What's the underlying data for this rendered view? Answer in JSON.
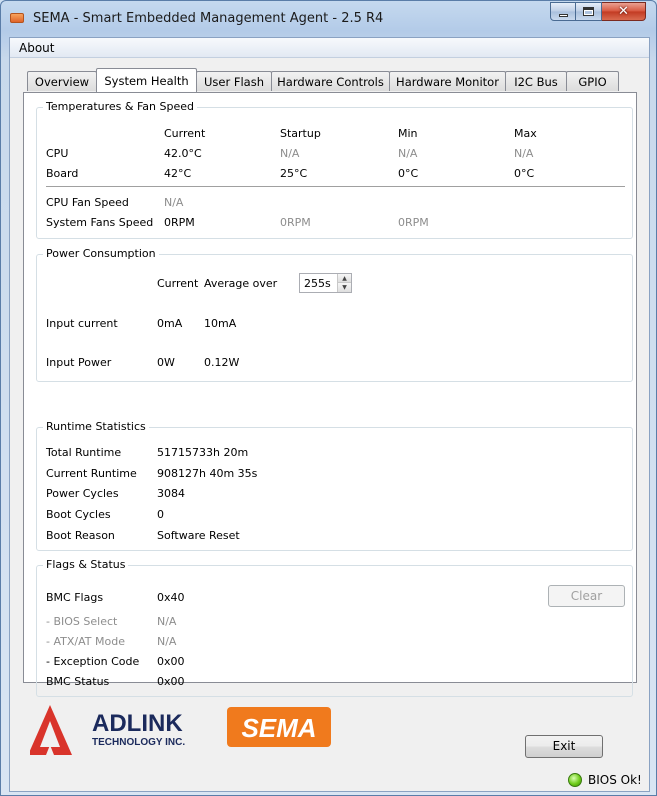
{
  "window": {
    "title": "SEMA - Smart Embedded Management Agent - 2.5 R4"
  },
  "menu": {
    "about": "About"
  },
  "tabs": [
    "Overview",
    "System Health",
    "User Flash",
    "Hardware Controls",
    "Hardware Monitor",
    "I2C Bus",
    "GPIO"
  ],
  "active_tab": "System Health",
  "temps": {
    "title": "Temperatures & Fan Speed",
    "headers": {
      "current": "Current",
      "startup": "Startup",
      "min": "Min",
      "max": "Max"
    },
    "cpu": {
      "label": "CPU",
      "current": "42.0°C",
      "startup": "N/A",
      "min": "N/A",
      "max": "N/A"
    },
    "board": {
      "label": "Board",
      "current": "42°C",
      "startup": "25°C",
      "min": "0°C",
      "max": "0°C"
    },
    "cpu_fan": {
      "label": "CPU Fan Speed",
      "value": "N/A"
    },
    "system_fans": {
      "label": "System Fans Speed",
      "v1": "0RPM",
      "v2": "0RPM",
      "v3": "0RPM"
    }
  },
  "power": {
    "title": "Power Consumption",
    "current_header": "Current",
    "average_label": "Average over",
    "average_value": "255s",
    "input_current": {
      "label": "Input current",
      "current": "0mA",
      "average": "10mA"
    },
    "input_power": {
      "label": "Input Power",
      "current": "0W",
      "average": "0.12W"
    }
  },
  "runtime": {
    "title": "Runtime Statistics",
    "total": {
      "label": "Total Runtime",
      "value": "51715733h 20m"
    },
    "current": {
      "label": "Current Runtime",
      "value": "908127h 40m 35s"
    },
    "power_cycles": {
      "label": "Power Cycles",
      "value": "3084"
    },
    "boot_cycles": {
      "label": "Boot Cycles",
      "value": "0"
    },
    "boot_reason": {
      "label": "Boot Reason",
      "value": "Software Reset"
    }
  },
  "flags": {
    "title": "Flags & Status",
    "bmc_flags": {
      "label": "BMC Flags",
      "value": "0x40"
    },
    "bios_select": {
      "label": "- BIOS Select",
      "value": "N/A"
    },
    "atx_at": {
      "label": "- ATX/AT Mode",
      "value": "N/A"
    },
    "exception": {
      "label": "- Exception Code",
      "value": "0x00"
    },
    "bmc_status": {
      "label": "BMC Status",
      "value": "0x00"
    },
    "clear_button": "Clear"
  },
  "branding": {
    "adlink": "ADLINK",
    "adlink_sub": "TECHNOLOGY INC.",
    "sema": "SEMA"
  },
  "exit_button": "Exit",
  "status": {
    "text": "BIOS Ok!",
    "indicator_color": "#6fcc1a"
  },
  "colors": {
    "accent_orange": "#f07a1d",
    "adlink_red": "#d9342b",
    "adlink_navy": "#1b2a5c"
  }
}
